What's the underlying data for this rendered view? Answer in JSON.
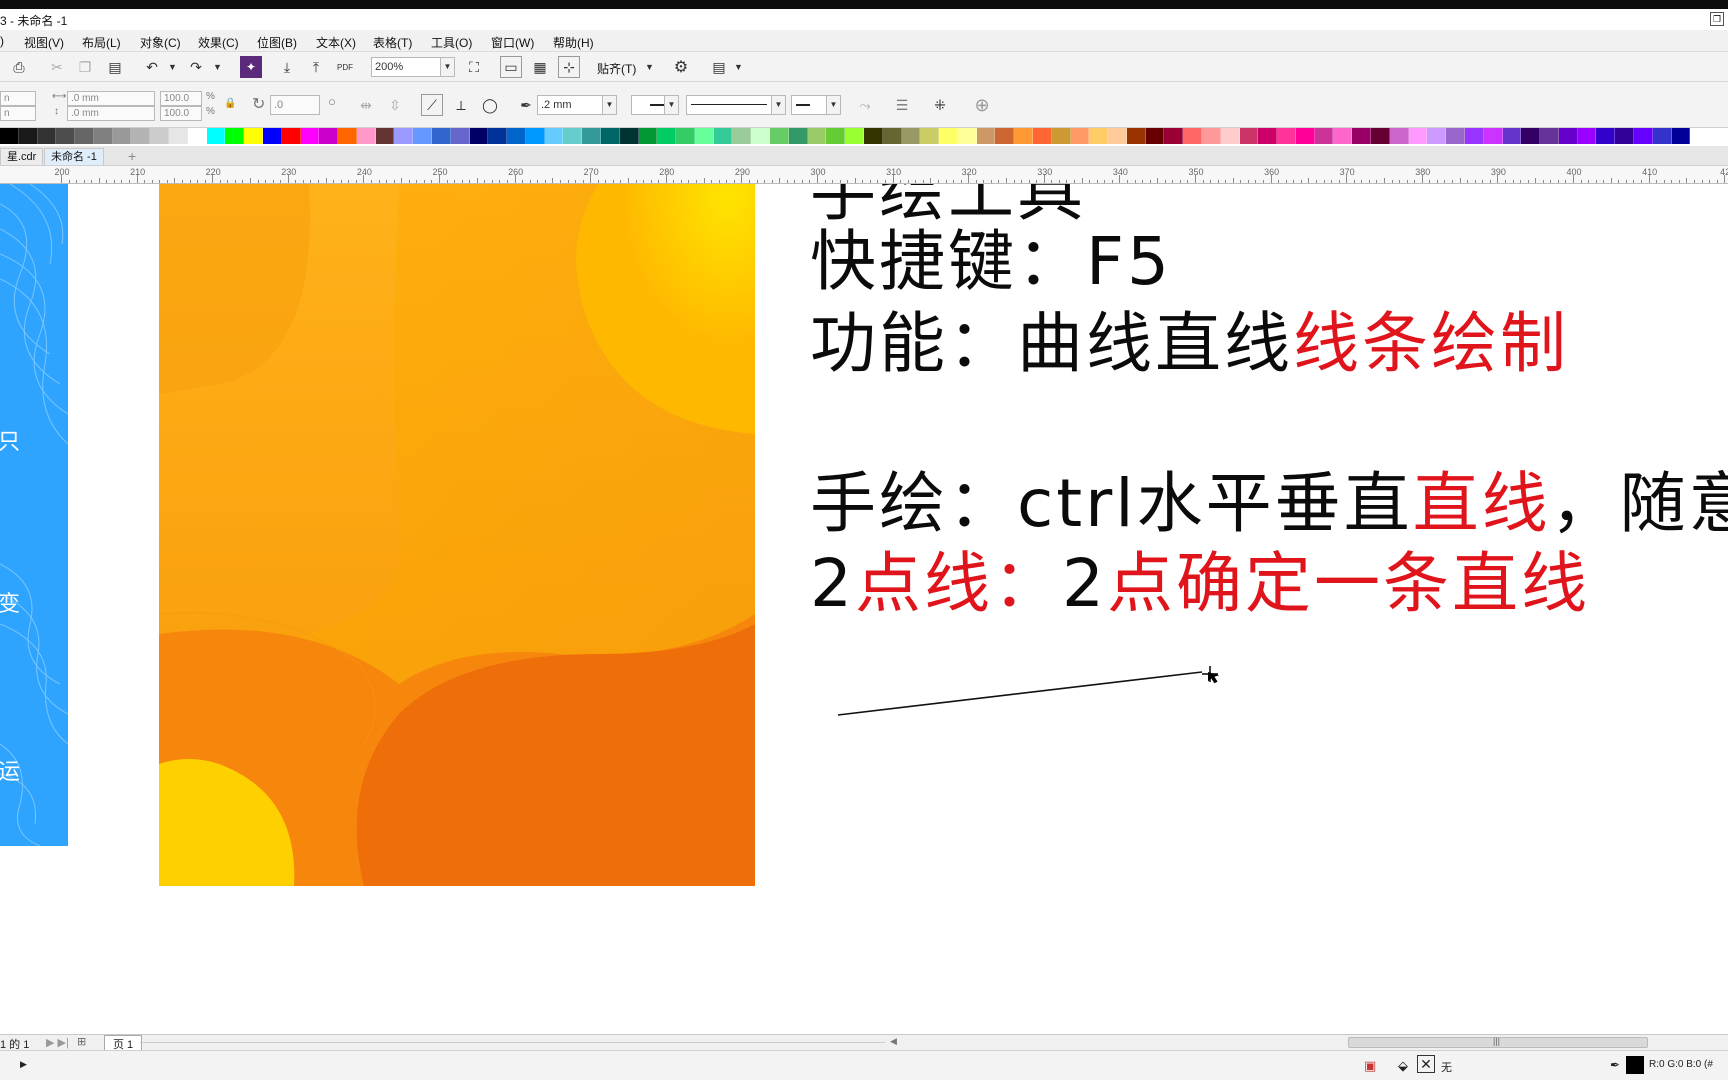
{
  "window": {
    "title": "3 - 未命名 -1"
  },
  "menu": [
    "视图(V)",
    "布局(L)",
    "对象(C)",
    "效果(C)",
    "位图(B)",
    "文本(X)",
    "表格(T)",
    "工具(O)",
    "窗口(W)",
    "帮助(H)"
  ],
  "menu_partial_first": ")",
  "toolbar": {
    "zoom_value": "200%",
    "snap_label": "贴齐(T)",
    "pdf_label": "PDF"
  },
  "property_bar": {
    "pos_x_partial": "n",
    "pos_y_partial": "n",
    "width_value": ".0 mm",
    "height_value": ".0 mm",
    "scale_x": "100.0",
    "scale_y": "100.0",
    "percent": "%",
    "rotation_value": ".0",
    "outline_width": ".2 mm"
  },
  "palette_colors": [
    "#000000",
    "#1a1a1a",
    "#333333",
    "#4d4d4d",
    "#666666",
    "#808080",
    "#999999",
    "#b3b3b3",
    "#cccccc",
    "#e6e6e6",
    "#ffffff",
    "#00ffff",
    "#00ff00",
    "#ffff00",
    "#0000ff",
    "#ff0000",
    "#ff00ff",
    "#cc00cc",
    "#ff6600",
    "#ff99cc",
    "#663333",
    "#9999ff",
    "#6699ff",
    "#3366cc",
    "#6666cc",
    "#000066",
    "#003399",
    "#0066cc",
    "#0099ff",
    "#66ccff",
    "#66cccc",
    "#339999",
    "#006666",
    "#003333",
    "#009933",
    "#00cc66",
    "#33cc66",
    "#66ff99",
    "#33cc99",
    "#99cc99",
    "#ccffcc",
    "#66cc66",
    "#339966",
    "#99cc66",
    "#66cc33",
    "#99ff33",
    "#333300",
    "#666633",
    "#999966",
    "#cccc66",
    "#ffff66",
    "#ffff99",
    "#cc9966",
    "#cc6633",
    "#ff9933",
    "#ff6633",
    "#cc9933",
    "#ff9966",
    "#ffcc66",
    "#ffcc99",
    "#993300",
    "#660000",
    "#990033",
    "#ff6666",
    "#ff9999",
    "#ffcccc",
    "#cc3366",
    "#cc0066",
    "#ff3399",
    "#ff0099",
    "#cc3399",
    "#ff66cc",
    "#990066",
    "#660033",
    "#cc66cc",
    "#ff99ff",
    "#cc99ff",
    "#9966cc",
    "#9933ff",
    "#cc33ff",
    "#6633cc",
    "#330066",
    "#663399",
    "#6600cc",
    "#9900ff",
    "#3300cc",
    "#330099",
    "#6600ff",
    "#3333cc",
    "#000099"
  ],
  "tabs": [
    {
      "label": "星.cdr"
    },
    {
      "label": "未命名 -1"
    },
    {
      "label": "+"
    }
  ],
  "ruler_labels": [
    "200",
    "210",
    "220",
    "230",
    "240",
    "250",
    "260",
    "270",
    "280",
    "290",
    "300",
    "310",
    "320",
    "330",
    "340",
    "350",
    "360",
    "370",
    "380",
    "390",
    "400",
    "410",
    "42"
  ],
  "sidebar_chars": [
    "只",
    "变",
    "运"
  ],
  "content": {
    "line1": "快捷键：F5",
    "line2_black": "功能：曲线直线",
    "line2_red": "线条绘制",
    "line3_black1": "手绘：ctrl水平垂直",
    "line3_red": "直线",
    "line3_black2": "，随意",
    "line4_black1": "2",
    "line4_red1": "点线：",
    "line4_black2": "2",
    "line4_red2": "点确定一条直线"
  },
  "pager": {
    "page_count": "1 的 1",
    "page_tab": "页 1"
  },
  "status": {
    "fill_label": "无",
    "color_readout": "R:0 G:0 B:0 (#"
  },
  "colors": {
    "accent_red": "#e0141b",
    "sidebar_blue": "#2ea4ff",
    "poster_orange": "#ee6e0a",
    "poster_yellow": "#ffd000"
  }
}
